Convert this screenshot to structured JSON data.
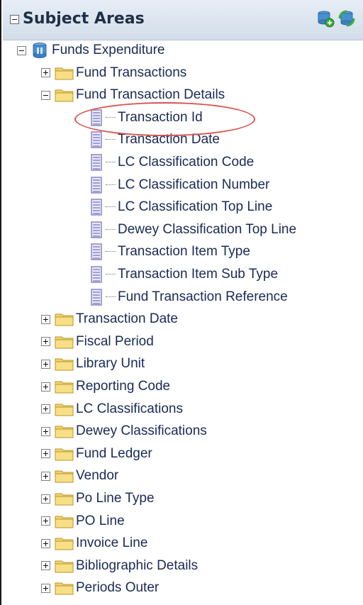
{
  "panel": {
    "title": "Subject Areas",
    "header_icons": [
      "add-subject-area-icon",
      "refresh-icon"
    ]
  },
  "tree": {
    "root": {
      "label": "Funds Expenditure",
      "icon": "subject-area-icon",
      "expanded": true
    },
    "folders_top": [
      {
        "label": "Fund Transactions",
        "expanded": false
      },
      {
        "label": "Fund Transaction Details",
        "expanded": true
      }
    ],
    "columns": [
      {
        "label": "Transaction Id",
        "highlighted": true
      },
      {
        "label": "Transaction Date"
      },
      {
        "label": "LC Classification Code"
      },
      {
        "label": "LC Classification Number"
      },
      {
        "label": "LC Classification Top Line"
      },
      {
        "label": "Dewey Classification Top Line"
      },
      {
        "label": "Transaction Item Type"
      },
      {
        "label": "Transaction Item Sub Type"
      },
      {
        "label": "Fund Transaction Reference"
      }
    ],
    "folders_bottom": [
      {
        "label": "Transaction Date"
      },
      {
        "label": "Fiscal Period"
      },
      {
        "label": "Library Unit"
      },
      {
        "label": "Reporting Code"
      },
      {
        "label": "LC Classifications"
      },
      {
        "label": "Dewey Classifications"
      },
      {
        "label": "Fund Ledger"
      },
      {
        "label": "Vendor"
      },
      {
        "label": "Po Line Type"
      },
      {
        "label": "PO Line"
      },
      {
        "label": "Invoice Line"
      },
      {
        "label": "Bibliographic Details"
      },
      {
        "label": "Periods Outer"
      }
    ]
  },
  "colors": {
    "folder": "#f2d36b",
    "column_icon": "#8a86c9",
    "highlight": "#d9534f"
  }
}
